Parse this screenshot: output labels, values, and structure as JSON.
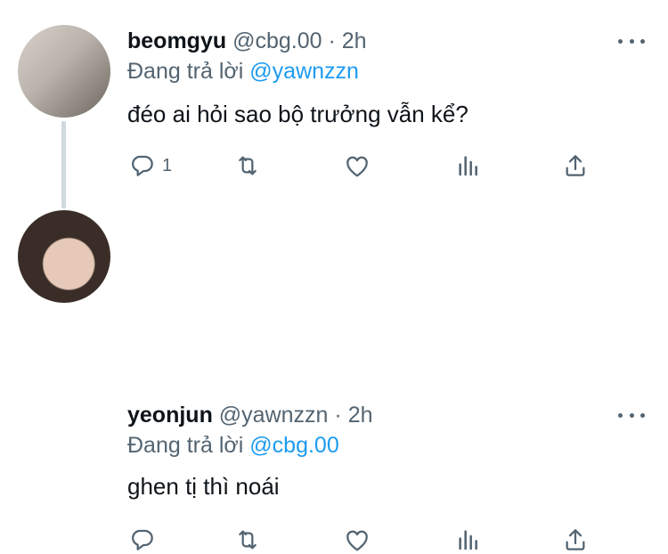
{
  "tweets": [
    {
      "name": "beomgyu",
      "handle": "@cbg.00",
      "separator": "·",
      "time": "2h",
      "reply_prefix": "Đang trả lời",
      "reply_handle": "@yawnzzn",
      "text": "đéo ai hỏi sao bộ trưởng vẫn kể?",
      "reply_count": "1"
    },
    {
      "name": "yeonjun",
      "handle": "@yawnzzn",
      "separator": "·",
      "time": "2h",
      "reply_prefix": "Đang trả lời",
      "reply_handle": "@cbg.00",
      "text": "ghen tị thì noái",
      "reply_count": ""
    }
  ],
  "icons": {
    "reply": "reply-icon",
    "retweet": "retweet-icon",
    "like": "heart-icon",
    "analytics": "analytics-icon",
    "share": "share-icon",
    "more": "more-icon"
  },
  "colors": {
    "text": "#0f1419",
    "secondary": "#536471",
    "link": "#1d9bf0",
    "thread_line": "#cfd9de"
  }
}
